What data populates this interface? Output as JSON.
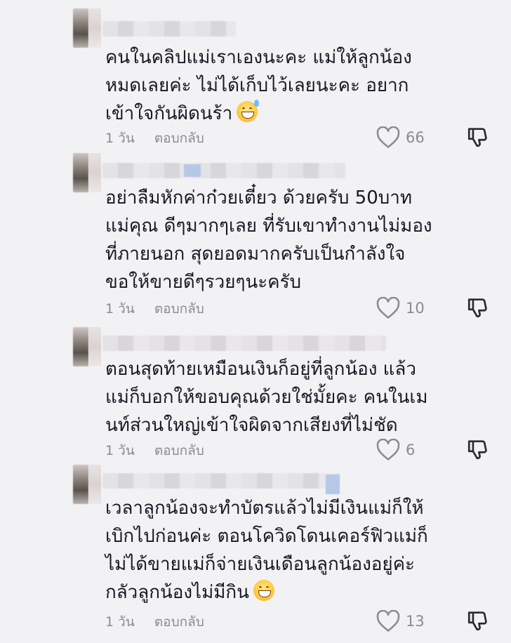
{
  "comments": [
    {
      "text": "คนในคลิปแม่เราเองนะคะ แม่ให้ลูกน้อง\nหมดเลยค่ะ ไม่ได้เก็บไว้เลยนะคะ อยาก\nเข้าใจกันผิดนร้า",
      "emoji": "sweat-smile-emoji",
      "time": "1 วัน",
      "reply": "ตอบกลับ",
      "likes": "66"
    },
    {
      "text": "อย่าลืมหักค่าก๋วยเตี๋ยว ด้วยครับ 50บาท\nแม่คุณ ดีๆมากๆเลย ที่รับเขาทำงานไม่มอง\nที่ภายนอก สุดยอดมากครับเป็นกำลังใจ\nขอให้ขายดีๆรวยๆนะครับ",
      "time": "1 วัน",
      "reply": "ตอบกลับ",
      "likes": "10"
    },
    {
      "text": "ตอนสุดท้ายเหมือนเงินก็อยู่ที่ลูกน้อง แล้ว\nแม่ก็บอกให้ขอบคุณด้วยใช่มั้ยคะ คนในเม\nนท์ส่วนใหญ่เข้าใจผิดจากเสียงที่ไม่ชัด",
      "time": "1 วัน",
      "reply": "ตอบกลับ",
      "likes": "6"
    },
    {
      "text": "เวลาลูกน้องจะทำบัตรแล้วไม่มีเงินแม่ก็ให้\nเบิกไปก่อนค่ะ ตอนโควิดโดนเคอร์ฟิวแม่ก็\nไม่ได้ขายแม่ก็จ่ายเงินเดือนลูกน้องอยู่ค่ะ\nกลัวลูกน้องไม่มีกิน",
      "emoji": "grin-emoji",
      "time": "1 วัน",
      "reply": "ตอบกลับ",
      "likes": "13"
    }
  ],
  "icons": {
    "like": "heart-outline-icon",
    "dislike": "thumbs-down-icon"
  },
  "colors": {
    "background": "#f2f2f4",
    "text": "#161823",
    "meta": "#8a8b91"
  }
}
